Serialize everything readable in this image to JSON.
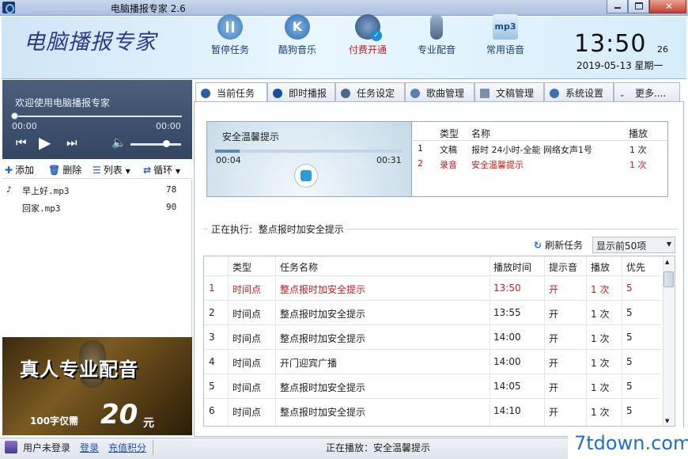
{
  "window": {
    "title": "电脑播报专家 2.6",
    "title_prefix": "————————"
  },
  "header": {
    "logo": "电脑播报专家",
    "buttons": [
      {
        "label": "暂停任务",
        "icon": "pause-icon"
      },
      {
        "label": "酷狗音乐",
        "icon": "kugou-icon"
      },
      {
        "label": "付费开通",
        "icon": "user-check-icon"
      },
      {
        "label": "专业配音",
        "icon": "microphone-icon"
      },
      {
        "label": "常用语音",
        "icon": "mp3-icon"
      }
    ],
    "clock": {
      "time": "13:50",
      "seconds": "26",
      "date": "2019-05-13  星期一"
    }
  },
  "player": {
    "welcome": "欢迎使用电脑播报专家",
    "time_left": "00:00",
    "time_right": "00:00",
    "volume": 0.7
  },
  "playlist_toolbar": {
    "add": "添加",
    "delete": "删除",
    "list": "列表",
    "loop": "循环"
  },
  "playlist": [
    {
      "name": "早上好.mp3",
      "value": "78"
    },
    {
      "name": "回家.mp3",
      "value": "90"
    }
  ],
  "ad": {
    "title": "真人专业配音",
    "sub": "100字仅需",
    "price": "20",
    "unit": "元"
  },
  "tabs": [
    "当前任务",
    "即时播报",
    "任务设定",
    "歌曲管理",
    "文稿管理",
    "系统设置",
    "更多...."
  ],
  "current": {
    "title": "安全温馨提示",
    "elapsed": "00:04",
    "total": "00:31",
    "progress": 0.13,
    "columns": [
      "类型",
      "名称",
      "播放"
    ],
    "rows": [
      {
        "no": "1",
        "type": "文稿",
        "name": "报时 24小时-全能 网络女声1号",
        "play": "1 次",
        "red": false
      },
      {
        "no": "2",
        "type": "录音",
        "name": "安全温馨提示",
        "play": "1 次",
        "red": true
      }
    ]
  },
  "executing": {
    "label": "正在执行:",
    "name": "整点报时加安全提示"
  },
  "refresh": "刷新任务",
  "show_select": "显示前50项",
  "tasks": {
    "columns": [
      "类型",
      "任务名称",
      "播放时间",
      "提示音",
      "播放",
      "优先"
    ],
    "rows": [
      {
        "no": "1",
        "type": "时间点",
        "name": "整点报时加安全提示",
        "time": "13:50",
        "tone": "开",
        "play": "1 次",
        "priority": "5",
        "red": true
      },
      {
        "no": "2",
        "type": "时间点",
        "name": "整点报时加安全提示",
        "time": "13:55",
        "tone": "开",
        "play": "1 次",
        "priority": "5",
        "red": false
      },
      {
        "no": "3",
        "type": "时间点",
        "name": "整点报时加安全提示",
        "time": "14:00",
        "tone": "开",
        "play": "1 次",
        "priority": "5",
        "red": false
      },
      {
        "no": "4",
        "type": "时间点",
        "name": "开门迎宾广播",
        "time": "14:00",
        "tone": "开",
        "play": "1 次",
        "priority": "5",
        "red": false
      },
      {
        "no": "5",
        "type": "时间点",
        "name": "整点报时加安全提示",
        "time": "14:05",
        "tone": "开",
        "play": "1 次",
        "priority": "5",
        "red": false
      },
      {
        "no": "6",
        "type": "时间点",
        "name": "整点报时加安全提示",
        "time": "14:10",
        "tone": "开",
        "play": "1 次",
        "priority": "5",
        "red": false
      }
    ]
  },
  "status": {
    "user": "用户未登录",
    "login": "登录",
    "recharge": "充值积分",
    "playing": "正在播放：安全温馨提示"
  },
  "watermark": {
    "text": "7tdown",
    "dot": ".",
    "suffix": "com"
  },
  "colors": {
    "accent": "#1f4fb5",
    "highlight": "#cc1a1a"
  }
}
